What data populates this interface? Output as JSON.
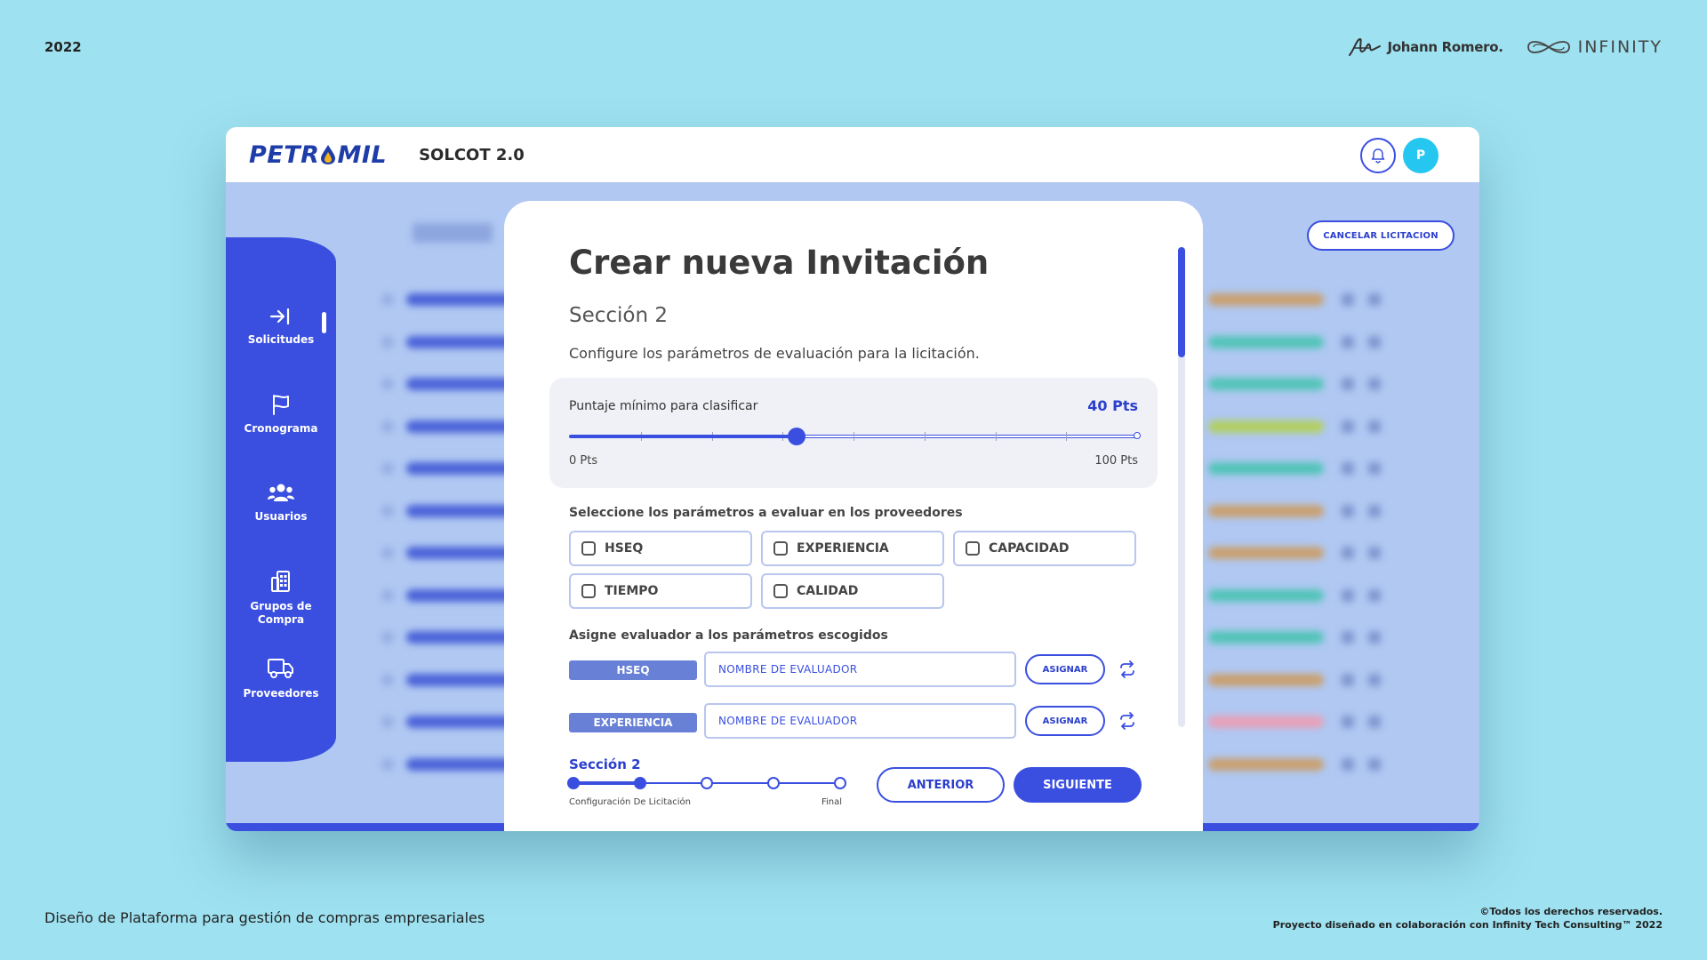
{
  "slide": {
    "year": "2022",
    "author": "Johann Romero.",
    "partner": "INFINITY",
    "footer_left": "Diseño de Plataforma para gestión de compras empresariales",
    "footer_right_line1": "©Todos los derechos reservados.",
    "footer_right_line2": "Proyecto diseñado en colaboración con Infinity Tech Consulting™ 2022"
  },
  "header": {
    "logo_left": "PETR",
    "logo_right": "MIL",
    "app_title": "SOLCOT 2.0",
    "avatar_initial": "P"
  },
  "background": {
    "cancel_label": "CANCELAR LICITACION",
    "status_colors": [
      "#c9a070",
      "#52c4b8",
      "#52c4b8",
      "#b2cf60",
      "#52c4b8",
      "#c9a070",
      "#c9a070",
      "#52c4b8",
      "#52c4b8",
      "#c9a070",
      "#e8a0b8",
      "#c9a070"
    ]
  },
  "sidebar": {
    "items": [
      {
        "label": "Solicitudes",
        "icon": "sign-in-icon"
      },
      {
        "label": "Cronograma",
        "icon": "flag-icon"
      },
      {
        "label": "Usuarios",
        "icon": "users-icon"
      },
      {
        "label": "Grupos de Compra",
        "icon": "building-icon"
      },
      {
        "label": "Proveedores",
        "icon": "truck-icon"
      }
    ]
  },
  "modal": {
    "title": "Crear nueva Invitación",
    "section": "Sección 2",
    "description": "Configure los parámetros de evaluación para la licitación.",
    "score": {
      "label": "Puntaje mínimo para clasificar",
      "value_label": "40 Pts",
      "value": 40,
      "min": 0,
      "max": 100,
      "min_label": "0 Pts",
      "max_label": "100 Pts"
    },
    "params_label": "Seleccione los parámetros a evaluar en los proveedores",
    "params": [
      "HSEQ",
      "EXPERIENCIA",
      "CAPACIDAD",
      "TIEMPO",
      "CALIDAD"
    ],
    "assign_label": "Asigne evaluador a los parámetros escogidos",
    "assignments": [
      {
        "tag": "HSEQ",
        "placeholder": "NOMBRE DE EVALUADOR",
        "button": "ASIGNAR"
      },
      {
        "tag": "EXPERIENCIA",
        "placeholder": "NOMBRE DE EVALUADOR",
        "button": "ASIGNAR"
      }
    ],
    "stepper": {
      "label": "Sección 2",
      "start_label": "Configuración De Licitación",
      "end_label": "Final",
      "current": 2,
      "total": 5
    },
    "prev_label": "ANTERIOR",
    "next_label": "SIGUIENTE"
  },
  "colors": {
    "accent": "#3a4fe0",
    "background": "#9ee1f0",
    "avatar": "#25c6f0"
  }
}
